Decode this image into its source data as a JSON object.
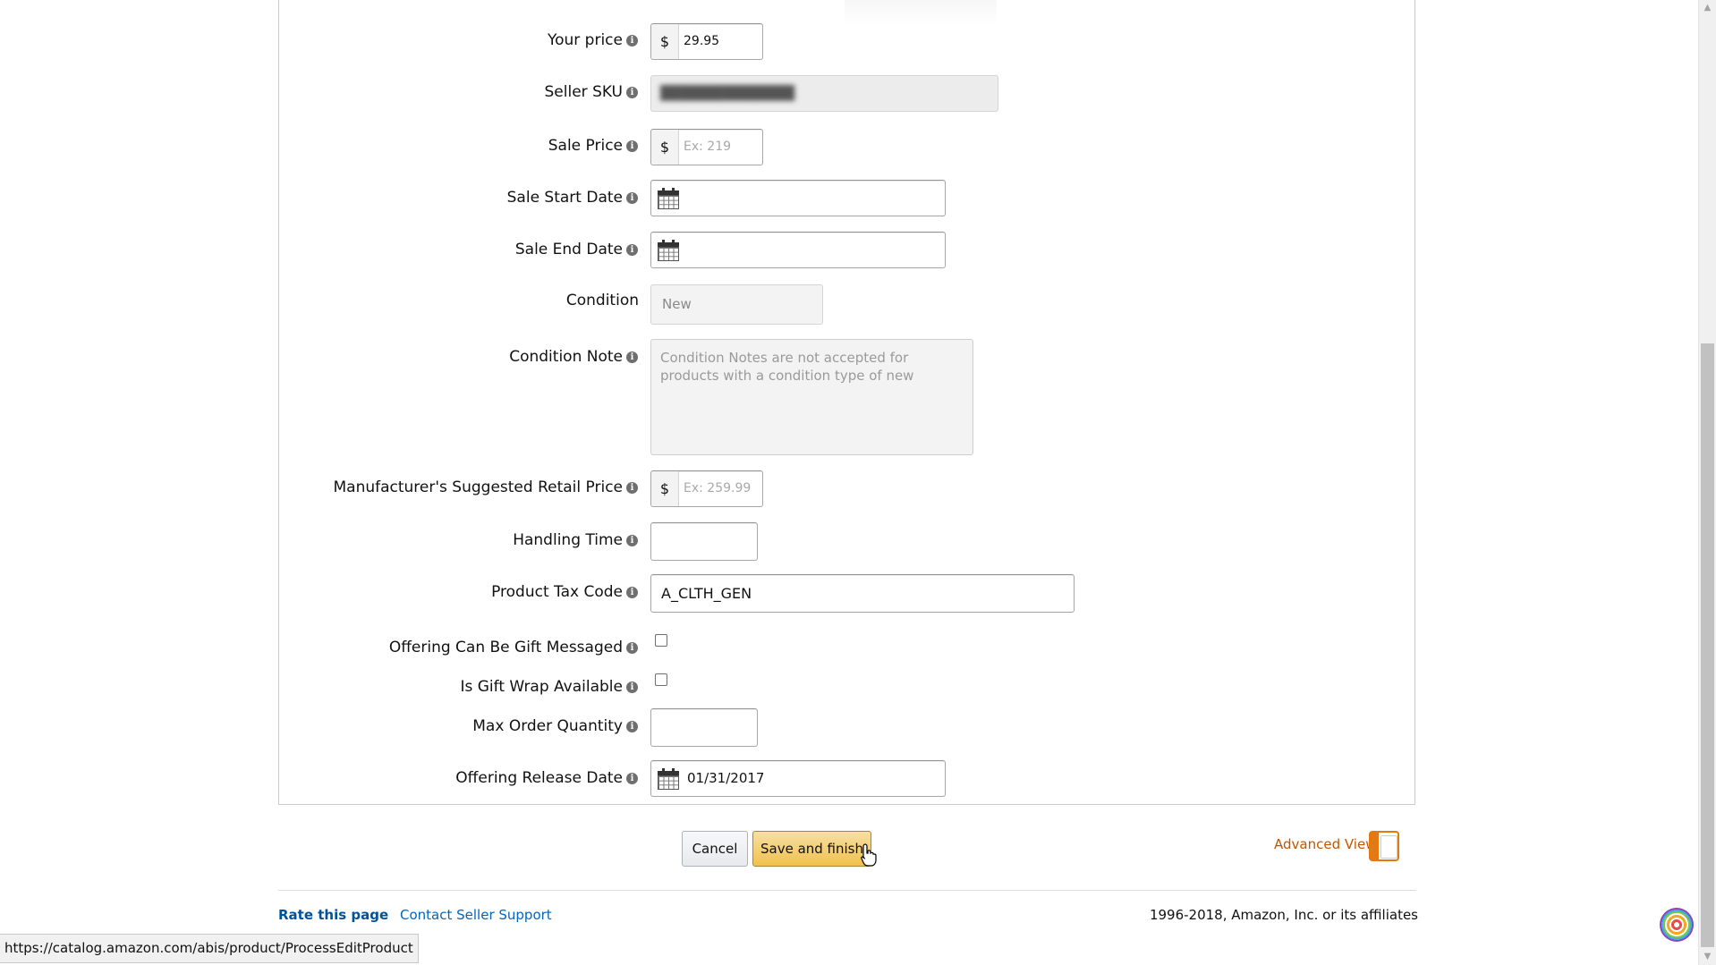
{
  "form": {
    "your_price": {
      "label": "Your price",
      "currency": "$",
      "value": "29.95"
    },
    "seller_sku": {
      "label": "Seller SKU",
      "value": ""
    },
    "sale_price": {
      "label": "Sale Price",
      "currency": "$",
      "placeholder": "Ex: 219"
    },
    "sale_start_date": {
      "label": "Sale Start Date",
      "value": ""
    },
    "sale_end_date": {
      "label": "Sale End Date",
      "value": ""
    },
    "condition": {
      "label": "Condition",
      "value": "New"
    },
    "condition_note": {
      "label": "Condition Note",
      "text": "Condition Notes are not accepted for products with a condition type of new"
    },
    "msrp": {
      "label": "Manufacturer's Suggested Retail Price",
      "currency": "$",
      "placeholder": "Ex: 259.99"
    },
    "handling_time": {
      "label": "Handling Time",
      "value": ""
    },
    "product_tax_code": {
      "label": "Product Tax Code",
      "value": "A_CLTH_GEN"
    },
    "gift_messaged": {
      "label": "Offering Can Be Gift Messaged",
      "checked": false
    },
    "gift_wrap": {
      "label": "Is Gift Wrap Available",
      "checked": false
    },
    "max_order_quantity": {
      "label": "Max Order Quantity",
      "value": ""
    },
    "release_date": {
      "label": "Offering Release Date",
      "value": "01/31/2017"
    }
  },
  "actions": {
    "cancel_label": "Cancel",
    "save_label": "Save and finish",
    "advanced_view_label": "Advanced View"
  },
  "footer": {
    "rate_label": "Rate this page",
    "support_label": "Contact Seller Support",
    "copyright": "1996-2018, Amazon, Inc. or its affiliates"
  },
  "status_bar": {
    "url": "https://catalog.amazon.com/abis/product/ProcessEditProduct"
  },
  "colors": {
    "link": "#0066c0",
    "accent_orange": "#e47911",
    "primary_button": "#f0c14b"
  }
}
